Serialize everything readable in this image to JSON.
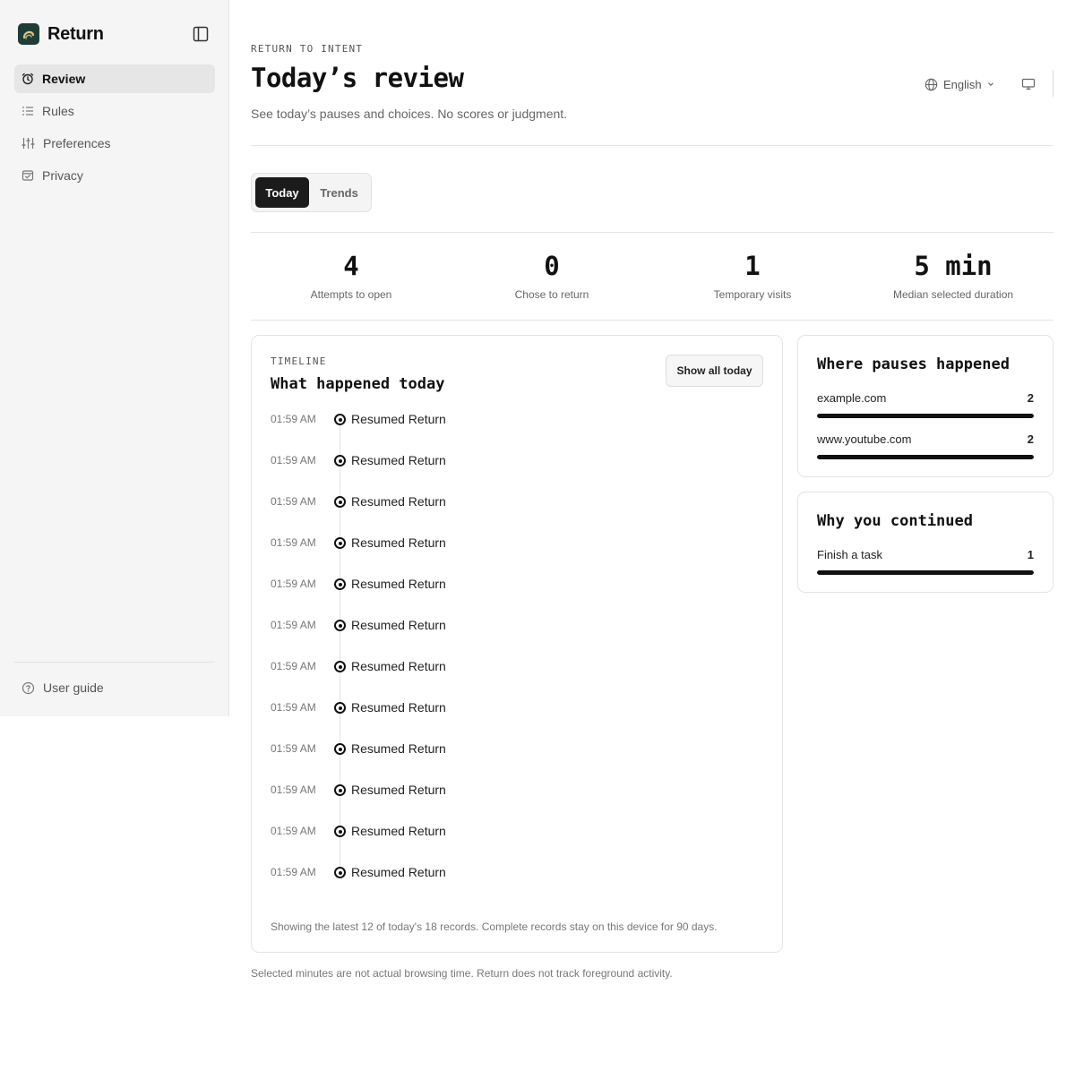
{
  "app": {
    "name": "Return"
  },
  "sidebar": {
    "items": [
      {
        "label": "Review",
        "icon": "alarm-clock-icon",
        "active": true
      },
      {
        "label": "Rules",
        "icon": "list-icon",
        "active": false
      },
      {
        "label": "Preferences",
        "icon": "sliders-icon",
        "active": false
      },
      {
        "label": "Privacy",
        "icon": "shield-check-icon",
        "active": false
      }
    ],
    "guide_label": "User guide"
  },
  "header": {
    "eyebrow": "RETURN TO INTENT",
    "title": "Today’s review",
    "subtitle": "See today’s pauses and choices. No scores or judgment.",
    "language": "English"
  },
  "tabs": [
    {
      "label": "Today",
      "active": true
    },
    {
      "label": "Trends",
      "active": false
    }
  ],
  "stats": [
    {
      "value": "4",
      "label": "Attempts to open"
    },
    {
      "value": "0",
      "label": "Chose to return"
    },
    {
      "value": "1",
      "label": "Temporary visits"
    },
    {
      "value": "5 min",
      "label": "Median selected duration"
    }
  ],
  "timeline": {
    "eyebrow": "TIMELINE",
    "title": "What happened today",
    "show_all_label": "Show all today",
    "events": [
      {
        "time": "01:59 AM",
        "label": "Resumed Return"
      },
      {
        "time": "01:59 AM",
        "label": "Resumed Return"
      },
      {
        "time": "01:59 AM",
        "label": "Resumed Return"
      },
      {
        "time": "01:59 AM",
        "label": "Resumed Return"
      },
      {
        "time": "01:59 AM",
        "label": "Resumed Return"
      },
      {
        "time": "01:59 AM",
        "label": "Resumed Return"
      },
      {
        "time": "01:59 AM",
        "label": "Resumed Return"
      },
      {
        "time": "01:59 AM",
        "label": "Resumed Return"
      },
      {
        "time": "01:59 AM",
        "label": "Resumed Return"
      },
      {
        "time": "01:59 AM",
        "label": "Resumed Return"
      },
      {
        "time": "01:59 AM",
        "label": "Resumed Return"
      },
      {
        "time": "01:59 AM",
        "label": "Resumed Return"
      }
    ],
    "footer": "Showing the latest 12 of today's 18 records. Complete records stay on this device for 90 days."
  },
  "where": {
    "title": "Where pauses happened",
    "items": [
      {
        "label": "example.com",
        "count": "2",
        "fraction": 1.0
      },
      {
        "label": "www.youtube.com",
        "count": "2",
        "fraction": 1.0
      }
    ]
  },
  "why": {
    "title": "Why you continued",
    "items": [
      {
        "label": "Finish a task",
        "count": "1",
        "fraction": 1.0
      }
    ]
  },
  "footer_note": "Selected minutes are not actual browsing time. Return does not track foreground activity.",
  "colors": {
    "accent": "#111111",
    "logo_bg": "#1f3d36",
    "logo_mark": "#e8c27a"
  }
}
